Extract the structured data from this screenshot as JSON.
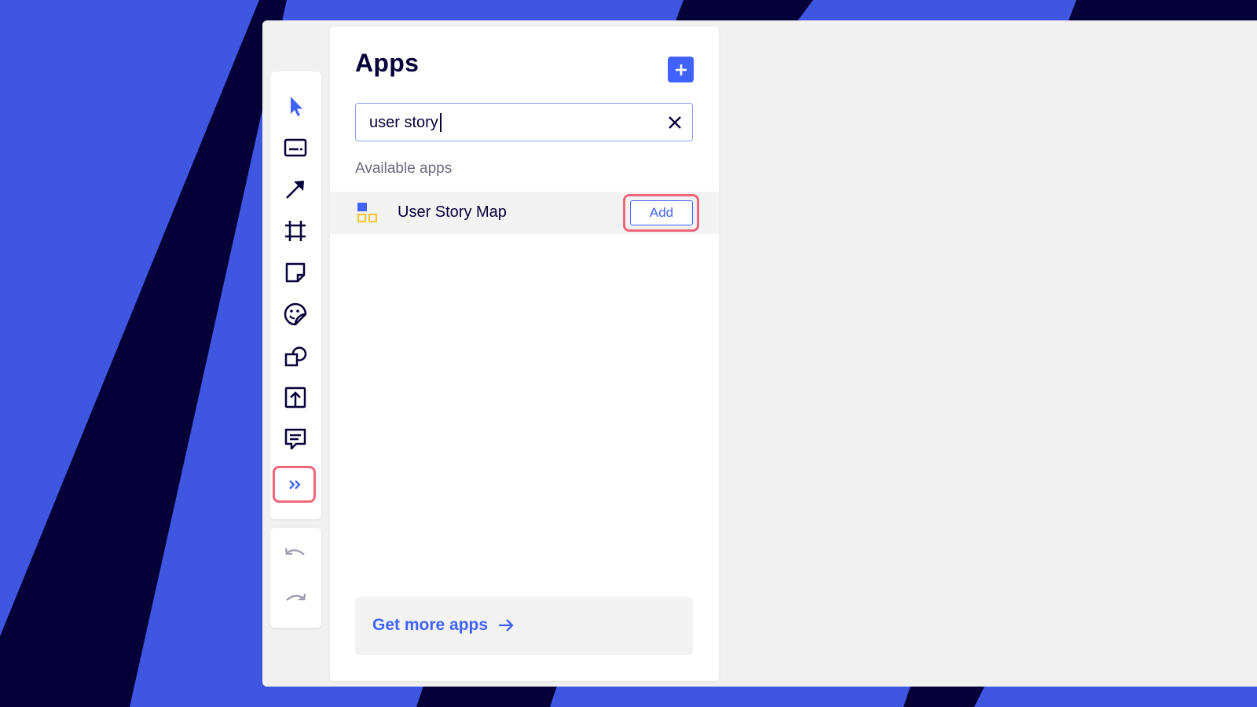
{
  "panel": {
    "title": "Apps",
    "add_icon": "plus-icon"
  },
  "search": {
    "value": "user story",
    "clear_icon": "close-icon"
  },
  "section": {
    "label": "Available apps"
  },
  "apps": [
    {
      "name": "User Story Map",
      "icon": "user-story-map-icon",
      "action_label": "Add"
    }
  ],
  "footer": {
    "link_label": "Get more apps",
    "link_icon": "arrow-right-icon"
  },
  "toolbar": {
    "tools": [
      "select-cursor-icon",
      "text-icon",
      "connection-line-icon",
      "frame-icon",
      "sticky-note-icon",
      "sticker-icon",
      "shapes-icon",
      "upload-icon",
      "comment-icon",
      "more-tools-icon"
    ],
    "history": [
      "undo-icon",
      "redo-icon"
    ]
  },
  "colors": {
    "accent": "#4262ff",
    "background_blue": "#3f56e0",
    "background_dark": "#050038",
    "highlight": "#f0667a",
    "app_icon_yellow": "#fcc839"
  }
}
